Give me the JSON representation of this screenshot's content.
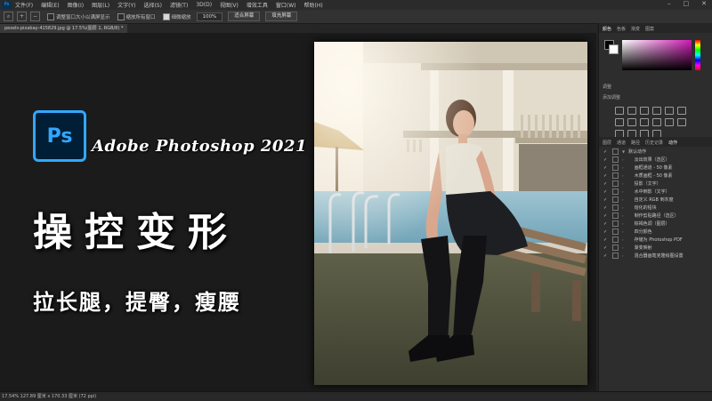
{
  "menu": [
    "文件(F)",
    "编辑(E)",
    "图像(I)",
    "图层(L)",
    "文字(Y)",
    "选择(S)",
    "滤镜(T)",
    "3D(D)",
    "视图(V)",
    "增效工具",
    "窗口(W)",
    "帮助(H)"
  ],
  "options": {
    "cb1": "调整窗口大小以满屏显示",
    "cb2": "缩放所有窗口",
    "cb3": "细微缩放",
    "zoom": "100%",
    "fit_screen": "适合屏幕",
    "fill_screen": "填充屏幕"
  },
  "doc_tab": "pexels-pixabay-415829.jpg @ 17.5%(图层 1, RGB/8) *",
  "panels": {
    "color_tabs": [
      "颜色",
      "色板",
      "渐变",
      "图案"
    ],
    "adjust_title": "调整",
    "adjust_add": "添加调整",
    "actions_tabs": [
      "图层",
      "通道",
      "路径",
      "历史记录",
      "动作"
    ],
    "actions": [
      "默认动作",
      "淡出效果（选区）",
      "画框通道 - 50 像素",
      "木质画框 - 50 像素",
      "投影（文字）",
      "水中倒影（文字）",
      "自定义 RGB 到灰度",
      "熔化的铅块",
      "制作剪贴路径（选区）",
      "棕褐色调（图层）",
      "四分颜色",
      "存储为 Photoshop PDF",
      "渐变映射",
      "混合器画笔克隆绘图设置"
    ]
  },
  "overlay": {
    "logo": "Ps",
    "brand": "Adobe Photoshop 2021",
    "headline": "操控变形",
    "subline": "拉长腿，提臀，瘦腰"
  },
  "status": "17.54%  127.89 厘米 x 170.33 厘米 (72 ppi)"
}
